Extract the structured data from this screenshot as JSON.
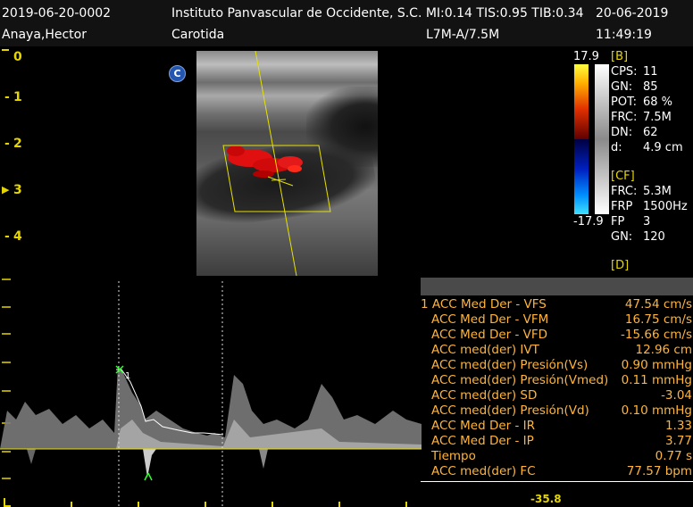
{
  "header": {
    "patient_id": "2019-06-20-0002",
    "institution": "Instituto Panvascular de Occidente, S.C. MI:0.14  TIS:0.95  TIB:0.34",
    "date": "20-06-2019",
    "patient_name": "Anaya,Hector",
    "exam": "Carotida",
    "probe": "L7M-A/7.5M",
    "time": "11:49:19"
  },
  "depth_scale": [
    "0",
    "1",
    "2",
    "3",
    "4"
  ],
  "mode_badge": "C",
  "color_scale": {
    "max": "17.9",
    "min": "-17.9"
  },
  "params": {
    "b_title": "[B]",
    "b": [
      {
        "k": "CPS:",
        "v": "11"
      },
      {
        "k": "GN:",
        "v": "85"
      },
      {
        "k": "POT:",
        "v": "68 %"
      },
      {
        "k": "FRC:",
        "v": "7.5M"
      },
      {
        "k": "DN:",
        "v": "62"
      },
      {
        "k": "d:",
        "v": "4.9 cm"
      }
    ],
    "cf_title": "[CF]",
    "cf": [
      {
        "k": "FRC:",
        "v": "5.3M"
      },
      {
        "k": "FRP",
        "v": "1500Hz"
      },
      {
        "k": "FP",
        "v": "3"
      },
      {
        "k": "GN:",
        "v": "120"
      }
    ],
    "d_title": "[D]"
  },
  "measurements": [
    {
      "label": "1 ACC Med Der - VFS",
      "value": "47.54 cm/s"
    },
    {
      "label": "ACC Med Der - VFM",
      "value": "16.75 cm/s"
    },
    {
      "label": "ACC Med Der - VFD",
      "value": "-15.66 cm/s"
    },
    {
      "label": "ACC med(der) IVT",
      "value": "12.96 cm"
    },
    {
      "label": "ACC med(der) Presión(Vs)",
      "value": "0.90 mmHg"
    },
    {
      "label": "ACC med(der) Presión(Vmed)",
      "value": "0.11 mmHg"
    },
    {
      "label": "ACC med(der) SD",
      "value": "-3.04"
    },
    {
      "label": "ACC med(der) Presión(Vd)",
      "value": "0.10 mmHg"
    },
    {
      "label": "ACC Med Der - IR",
      "value": "1.33"
    },
    {
      "label": "ACC Med Der - IP",
      "value": "3.77"
    },
    {
      "label": "Tiempo",
      "value": "0.77 s"
    },
    {
      "label": "ACC med(der) FC",
      "value": "77.57 bpm"
    }
  ],
  "spectrum": {
    "cursor_label": "1",
    "scale_bottom": "-35.8"
  }
}
